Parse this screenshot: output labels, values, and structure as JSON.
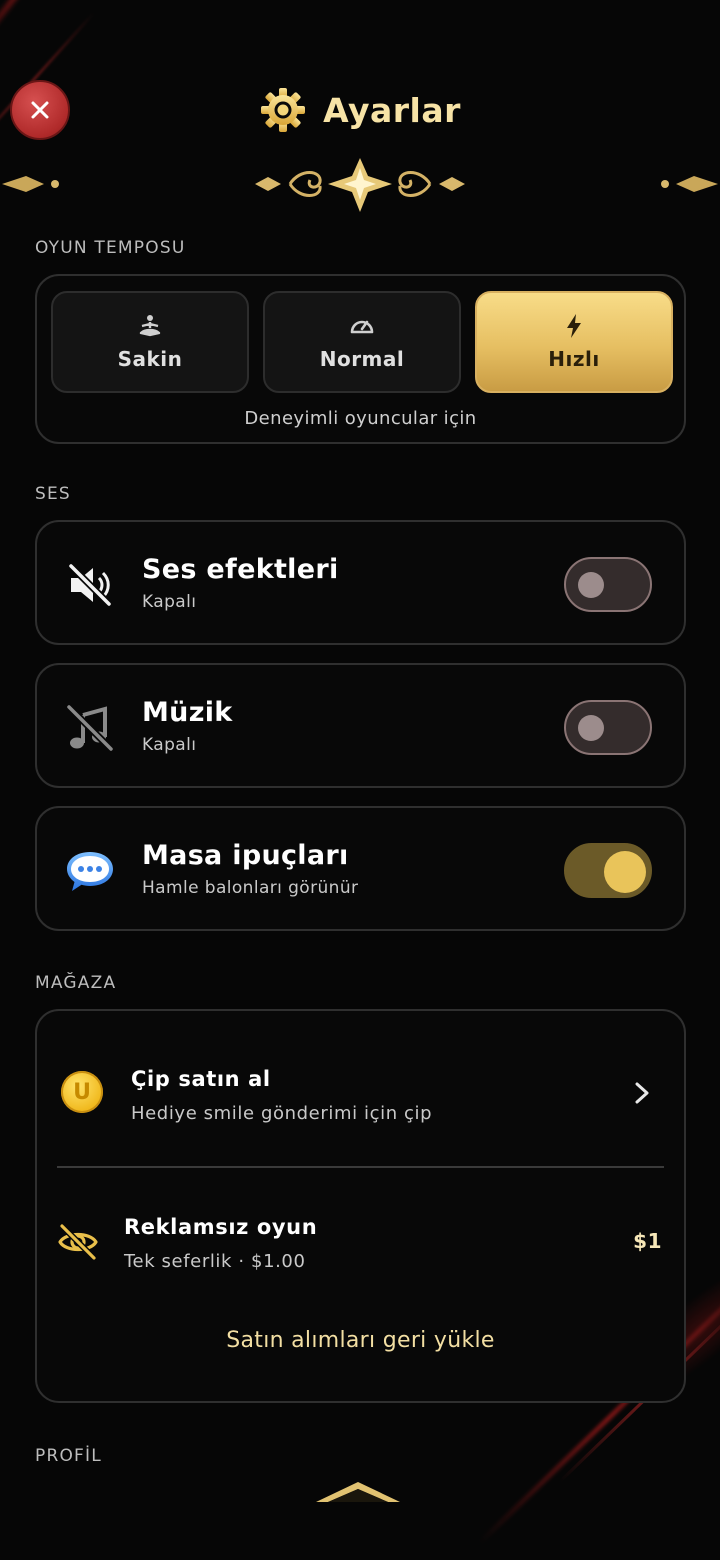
{
  "header": {
    "title": "Ayarlar",
    "close_icon": "close-icon",
    "title_icon": "gear-icon"
  },
  "tempo": {
    "section_label": "OYUN TEMPOSU",
    "options": [
      {
        "label": "Sakin",
        "icon": "meditation-icon",
        "selected": false
      },
      {
        "label": "Normal",
        "icon": "speedometer-icon",
        "selected": false
      },
      {
        "label": "Hızlı",
        "icon": "lightning-icon",
        "selected": true
      }
    ],
    "description": "Deneyimli oyuncular için"
  },
  "sound": {
    "section_label": "SES",
    "rows": [
      {
        "title": "Ses efektleri",
        "subtitle": "Kapalı",
        "icon": "speaker-muted-icon",
        "enabled": false
      },
      {
        "title": "Müzik",
        "subtitle": "Kapalı",
        "icon": "music-off-icon",
        "enabled": false
      },
      {
        "title": "Masa ipuçları",
        "subtitle": "Hamle balonları görünür",
        "icon": "chat-bubble-icon",
        "enabled": true
      }
    ]
  },
  "store": {
    "section_label": "MAĞAZA",
    "chips": {
      "title": "Çip satın al",
      "subtitle": "Hediye smile gönderimi için çip",
      "icon": "coin-icon",
      "coin_letter": "U"
    },
    "no_ads": {
      "title": "Reklamsız oyun",
      "subtitle": "Tek seferlik · $1.00",
      "price": "$1",
      "icon": "eye-off-icon"
    },
    "restore_label": "Satın alımları geri yükle"
  },
  "profile": {
    "section_label": "PROFİL"
  },
  "colors": {
    "accent_gold": "#f7e3a6",
    "active_gold": "#e6bf62",
    "close_red": "#c03838",
    "background": "#060606"
  }
}
